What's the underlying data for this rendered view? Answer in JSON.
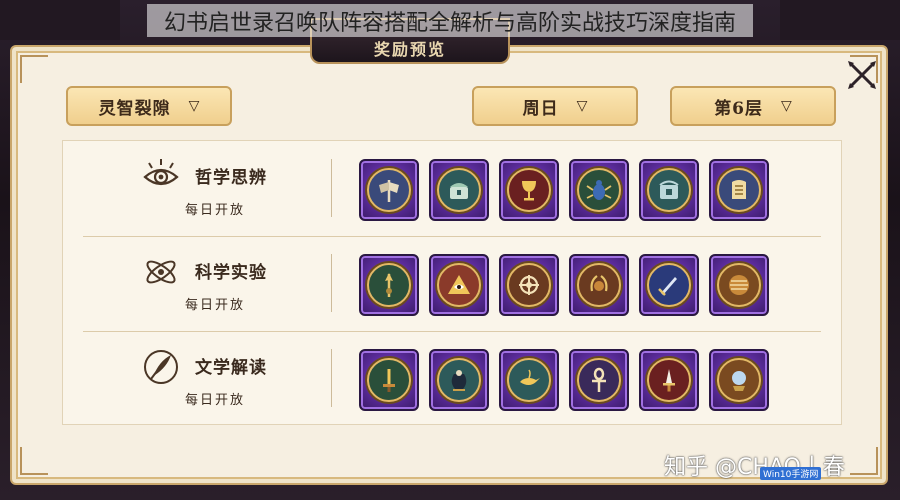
{
  "overlay_caption": "幻书启世录召唤队阵容搭配全解析与高阶实战技巧深度指南",
  "window": {
    "title": "奖励预览"
  },
  "filters": {
    "realm": {
      "label": "灵智裂隙",
      "icon": "chevron-down-icon"
    },
    "day": {
      "label": "周日",
      "icon": "chevron-down-icon"
    },
    "floor": {
      "label": "第6层",
      "icon": "chevron-down-icon"
    }
  },
  "categories": [
    {
      "name": "哲学思辨",
      "schedule": "每日开放",
      "icon": "eye-icon",
      "rewards": [
        {
          "icon": "axe-icon",
          "medal": "#3a4a7a"
        },
        {
          "icon": "chest-icon",
          "medal": "#2d5a5a"
        },
        {
          "icon": "goblet-icon",
          "medal": "#6a2020"
        },
        {
          "icon": "scarab-icon",
          "medal": "#2a4f3a"
        },
        {
          "icon": "cage-icon",
          "medal": "#2d5a5a"
        },
        {
          "icon": "tablet-icon",
          "medal": "#3a4a7a"
        }
      ]
    },
    {
      "name": "科学实验",
      "schedule": "每日开放",
      "icon": "atom-icon",
      "rewards": [
        {
          "icon": "spear-icon",
          "medal": "#2a4f3a"
        },
        {
          "icon": "pyramid-eye-icon",
          "medal": "#8a3a2a"
        },
        {
          "icon": "ornament-icon",
          "medal": "#6a3a20"
        },
        {
          "icon": "laurel-icon",
          "medal": "#6a3a20"
        },
        {
          "icon": "dagger-icon",
          "medal": "#2a3a7a"
        },
        {
          "icon": "shield-icon",
          "medal": "#7a4a20"
        }
      ]
    },
    {
      "name": "文学解读",
      "schedule": "每日开放",
      "icon": "quill-icon",
      "rewards": [
        {
          "icon": "sword-icon",
          "medal": "#2a4f3a"
        },
        {
          "icon": "urn-icon",
          "medal": "#2d5a5a"
        },
        {
          "icon": "lamp-icon",
          "medal": "#2d5a5a"
        },
        {
          "icon": "ankh-icon",
          "medal": "#3a2a5a"
        },
        {
          "icon": "blade-icon",
          "medal": "#6a2020"
        },
        {
          "icon": "crystal-ball-icon",
          "medal": "#7a4a20"
        }
      ]
    }
  ],
  "watermark": {
    "text": "知乎 @CHAO丨春",
    "site": "Win10手游网"
  }
}
